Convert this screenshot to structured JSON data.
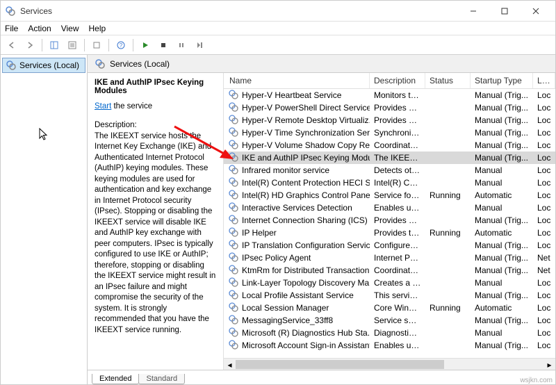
{
  "window": {
    "title": "Services"
  },
  "menu": {
    "file": "File",
    "action": "Action",
    "view": "View",
    "help": "Help"
  },
  "tree": {
    "root": "Services (Local)"
  },
  "paneHeader": "Services (Local)",
  "detail": {
    "title": "IKE and AuthIP IPsec Keying Modules",
    "startLink": "Start",
    "startSuffix": " the service",
    "descLabel": "Description:",
    "description": "The IKEEXT service hosts the Internet Key Exchange (IKE) and Authenticated Internet Protocol (AuthIP) keying modules. These keying modules are used for authentication and key exchange in Internet Protocol security (IPsec). Stopping or disabling the IKEEXT service will disable IKE and AuthIP key exchange with peer computers. IPsec is typically configured to use IKE or AuthIP; therefore, stopping or disabling the IKEEXT service might result in an IPsec failure and might compromise the security of the system. It is strongly recommended that you have the IKEEXT service running."
  },
  "columns": {
    "name": "Name",
    "description": "Description",
    "status": "Status",
    "startup": "Startup Type",
    "logon": "Log"
  },
  "rows": [
    {
      "name": "Hyper-V Heartbeat Service",
      "desc": "Monitors th...",
      "status": "",
      "type": "Manual (Trig...",
      "log": "Loc"
    },
    {
      "name": "Hyper-V PowerShell Direct Service",
      "desc": "Provides a ...",
      "status": "",
      "type": "Manual (Trig...",
      "log": "Loc"
    },
    {
      "name": "Hyper-V Remote Desktop Virtualiz...",
      "desc": "Provides a p...",
      "status": "",
      "type": "Manual (Trig...",
      "log": "Loc"
    },
    {
      "name": "Hyper-V Time Synchronization Ser...",
      "desc": "Synchronize...",
      "status": "",
      "type": "Manual (Trig...",
      "log": "Loc"
    },
    {
      "name": "Hyper-V Volume Shadow Copy Re...",
      "desc": "Coordinates...",
      "status": "",
      "type": "Manual (Trig...",
      "log": "Loc"
    },
    {
      "name": "IKE and AuthIP IPsec Keying Modu...",
      "desc": "The IKEEXT ...",
      "status": "",
      "type": "Manual (Trig...",
      "log": "Loc",
      "selected": true
    },
    {
      "name": "Infrared monitor service",
      "desc": "Detects oth...",
      "status": "",
      "type": "Manual",
      "log": "Loc"
    },
    {
      "name": "Intel(R) Content Protection HECI S...",
      "desc": "Intel(R) Con...",
      "status": "",
      "type": "Manual",
      "log": "Loc"
    },
    {
      "name": "Intel(R) HD Graphics Control Panel...",
      "desc": "Service for I...",
      "status": "Running",
      "type": "Automatic",
      "log": "Loc"
    },
    {
      "name": "Interactive Services Detection",
      "desc": "Enables use...",
      "status": "",
      "type": "Manual",
      "log": "Loc"
    },
    {
      "name": "Internet Connection Sharing (ICS)",
      "desc": "Provides ne...",
      "status": "",
      "type": "Manual (Trig...",
      "log": "Loc"
    },
    {
      "name": "IP Helper",
      "desc": "Provides tu...",
      "status": "Running",
      "type": "Automatic",
      "log": "Loc"
    },
    {
      "name": "IP Translation Configuration Service",
      "desc": "Configures ...",
      "status": "",
      "type": "Manual (Trig...",
      "log": "Loc"
    },
    {
      "name": "IPsec Policy Agent",
      "desc": "Internet Pro...",
      "status": "",
      "type": "Manual (Trig...",
      "log": "Net"
    },
    {
      "name": "KtmRm for Distributed Transaction...",
      "desc": "Coordinates...",
      "status": "",
      "type": "Manual (Trig...",
      "log": "Net"
    },
    {
      "name": "Link-Layer Topology Discovery Ma...",
      "desc": "Creates a N...",
      "status": "",
      "type": "Manual",
      "log": "Loc"
    },
    {
      "name": "Local Profile Assistant Service",
      "desc": "This service ...",
      "status": "",
      "type": "Manual (Trig...",
      "log": "Loc"
    },
    {
      "name": "Local Session Manager",
      "desc": "Core Windo...",
      "status": "Running",
      "type": "Automatic",
      "log": "Loc"
    },
    {
      "name": "MessagingService_33ff8",
      "desc": "Service sup...",
      "status": "",
      "type": "Manual (Trig...",
      "log": "Loc"
    },
    {
      "name": "Microsoft (R) Diagnostics Hub Sta...",
      "desc": "Diagnostics ...",
      "status": "",
      "type": "Manual",
      "log": "Loc"
    },
    {
      "name": "Microsoft Account Sign-in Assistant",
      "desc": "Enables use...",
      "status": "",
      "type": "Manual (Trig...",
      "log": "Loc"
    }
  ],
  "tabs": {
    "extended": "Extended",
    "standard": "Standard"
  },
  "watermark": "wsjkn.com"
}
